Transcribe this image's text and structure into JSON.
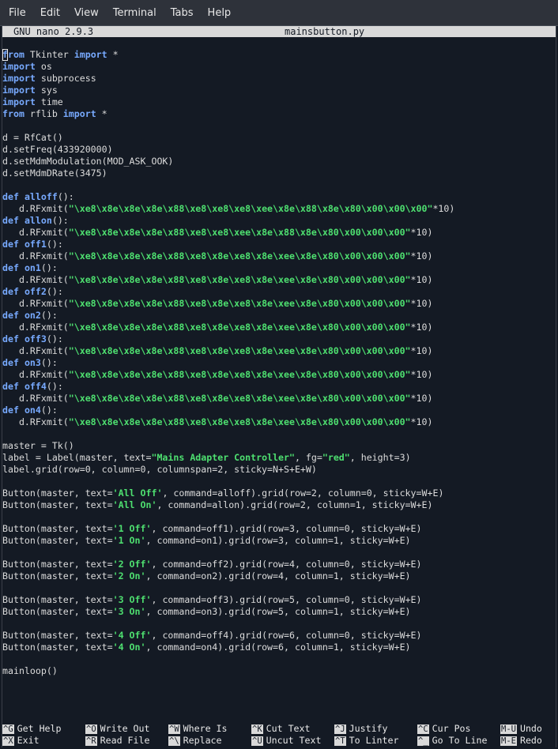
{
  "menubar": {
    "items": [
      "File",
      "Edit",
      "View",
      "Terminal",
      "Tabs",
      "Help"
    ]
  },
  "nano": {
    "version": "GNU nano 2.9.3",
    "filename": "mainsbutton.py"
  },
  "code_lines": [
    [
      [
        "kw",
        "from"
      ],
      [
        "p",
        " Tkinter "
      ],
      [
        "kw",
        "import"
      ],
      [
        "p",
        " *"
      ]
    ],
    [
      [
        "kw",
        "import"
      ],
      [
        "p",
        " os"
      ]
    ],
    [
      [
        "kw",
        "import"
      ],
      [
        "p",
        " subprocess"
      ]
    ],
    [
      [
        "kw",
        "import"
      ],
      [
        "p",
        " sys"
      ]
    ],
    [
      [
        "kw",
        "import"
      ],
      [
        "p",
        " time"
      ]
    ],
    [
      [
        "kw",
        "from"
      ],
      [
        "p",
        " rflib "
      ],
      [
        "kw",
        "import"
      ],
      [
        "p",
        " *"
      ]
    ],
    [],
    [
      [
        "p",
        "d = RfCat()"
      ]
    ],
    [
      [
        "p",
        "d.setFreq(433920000)"
      ]
    ],
    [
      [
        "p",
        "d.setMdmModulation(MOD_ASK_OOK)"
      ]
    ],
    [
      [
        "p",
        "d.setMdmDRate(3475)"
      ]
    ],
    [],
    [
      [
        "kw",
        "def"
      ],
      [
        "p",
        " "
      ],
      [
        "fn",
        "alloff"
      ],
      [
        "p",
        "():"
      ]
    ],
    [
      [
        "p",
        "   d.RFxmit("
      ],
      [
        "str",
        "\"\\xe8\\x8e\\x8e\\x8e\\x88\\xe8\\xe8\\xe8\\xee\\x8e\\x88\\x8e\\x80\\x00\\x00\\x00\""
      ],
      [
        "p",
        "*10)"
      ]
    ],
    [
      [
        "kw",
        "def"
      ],
      [
        "p",
        " "
      ],
      [
        "fn",
        "allon"
      ],
      [
        "p",
        "():"
      ]
    ],
    [
      [
        "p",
        "   d.RFxmit("
      ],
      [
        "str",
        "\"\\xe8\\x8e\\x8e\\x8e\\x88\\xe8\\xe8\\xee\\x8e\\x88\\x8e\\x80\\x00\\x00\\x00\""
      ],
      [
        "p",
        "*10)"
      ]
    ],
    [
      [
        "kw",
        "def"
      ],
      [
        "p",
        " "
      ],
      [
        "fn",
        "off1"
      ],
      [
        "p",
        "():"
      ]
    ],
    [
      [
        "p",
        "   d.RFxmit("
      ],
      [
        "str",
        "\"\\xe8\\x8e\\x8e\\x8e\\x88\\xe8\\x8e\\xe8\\x8e\\xee\\x8e\\x80\\x00\\x00\\x00\""
      ],
      [
        "p",
        "*10)"
      ]
    ],
    [
      [
        "kw",
        "def"
      ],
      [
        "p",
        " "
      ],
      [
        "fn",
        "on1"
      ],
      [
        "p",
        "():"
      ]
    ],
    [
      [
        "p",
        "   d.RFxmit("
      ],
      [
        "str",
        "\"\\xe8\\x8e\\x8e\\x8e\\x88\\xe8\\x8e\\xe8\\x8e\\xee\\x8e\\x80\\x00\\x00\\x00\""
      ],
      [
        "p",
        "*10)"
      ]
    ],
    [
      [
        "kw",
        "def"
      ],
      [
        "p",
        " "
      ],
      [
        "fn",
        "off2"
      ],
      [
        "p",
        "():"
      ]
    ],
    [
      [
        "p",
        "   d.RFxmit("
      ],
      [
        "str",
        "\"\\xe8\\x8e\\x8e\\x8e\\x88\\xe8\\x8e\\xe8\\x8e\\xee\\x8e\\x80\\x00\\x00\\x00\""
      ],
      [
        "p",
        "*10)"
      ]
    ],
    [
      [
        "kw",
        "def"
      ],
      [
        "p",
        " "
      ],
      [
        "fn",
        "on2"
      ],
      [
        "p",
        "():"
      ]
    ],
    [
      [
        "p",
        "   d.RFxmit("
      ],
      [
        "str",
        "\"\\xe8\\x8e\\x8e\\x8e\\x88\\xe8\\x8e\\xe8\\x8e\\xee\\x8e\\x80\\x00\\x00\\x00\""
      ],
      [
        "p",
        "*10)"
      ]
    ],
    [
      [
        "kw",
        "def"
      ],
      [
        "p",
        " "
      ],
      [
        "fn",
        "off3"
      ],
      [
        "p",
        "():"
      ]
    ],
    [
      [
        "p",
        "   d.RFxmit("
      ],
      [
        "str",
        "\"\\xe8\\x8e\\x8e\\x8e\\x88\\xe8\\x8e\\xe8\\x8e\\xee\\x8e\\x80\\x00\\x00\\x00\""
      ],
      [
        "p",
        "*10)"
      ]
    ],
    [
      [
        "kw",
        "def"
      ],
      [
        "p",
        " "
      ],
      [
        "fn",
        "on3"
      ],
      [
        "p",
        "():"
      ]
    ],
    [
      [
        "p",
        "   d.RFxmit("
      ],
      [
        "str",
        "\"\\xe8\\x8e\\x8e\\x8e\\x88\\xe8\\x8e\\xe8\\x8e\\xee\\x8e\\x80\\x00\\x00\\x00\""
      ],
      [
        "p",
        "*10)"
      ]
    ],
    [
      [
        "kw",
        "def"
      ],
      [
        "p",
        " "
      ],
      [
        "fn",
        "off4"
      ],
      [
        "p",
        "():"
      ]
    ],
    [
      [
        "p",
        "   d.RFxmit("
      ],
      [
        "str",
        "\"\\xe8\\x8e\\x8e\\x8e\\x88\\xe8\\x8e\\xe8\\x8e\\xee\\x8e\\x80\\x00\\x00\\x00\""
      ],
      [
        "p",
        "*10)"
      ]
    ],
    [
      [
        "kw",
        "def"
      ],
      [
        "p",
        " "
      ],
      [
        "fn",
        "on4"
      ],
      [
        "p",
        "():"
      ]
    ],
    [
      [
        "p",
        "   d.RFxmit("
      ],
      [
        "str",
        "\"\\xe8\\x8e\\x8e\\x8e\\x88\\xe8\\x8e\\xe8\\x8e\\xee\\x8e\\x80\\x00\\x00\\x00\""
      ],
      [
        "p",
        "*10)"
      ]
    ],
    [],
    [
      [
        "p",
        "master = Tk()"
      ]
    ],
    [
      [
        "p",
        "label = Label(master, text="
      ],
      [
        "str",
        "\"Mains Adapter Controller\""
      ],
      [
        "p",
        ", fg="
      ],
      [
        "str",
        "\"red\""
      ],
      [
        "p",
        ", height=3)"
      ]
    ],
    [
      [
        "p",
        "label.grid(row=0, column=0, columnspan=2, sticky=N+S+E+W)"
      ]
    ],
    [],
    [
      [
        "p",
        "Button(master, text="
      ],
      [
        "str",
        "'All Off'"
      ],
      [
        "p",
        ", command=alloff).grid(row=2, column=0, sticky=W+E)"
      ]
    ],
    [
      [
        "p",
        "Button(master, text="
      ],
      [
        "str",
        "'All On'"
      ],
      [
        "p",
        ", command=allon).grid(row=2, column=1, sticky=W+E)"
      ]
    ],
    [],
    [
      [
        "p",
        "Button(master, text="
      ],
      [
        "str",
        "'1 Off'"
      ],
      [
        "p",
        ", command=off1).grid(row=3, column=0, sticky=W+E)"
      ]
    ],
    [
      [
        "p",
        "Button(master, text="
      ],
      [
        "str",
        "'1 On'"
      ],
      [
        "p",
        ", command=on1).grid(row=3, column=1, sticky=W+E)"
      ]
    ],
    [],
    [
      [
        "p",
        "Button(master, text="
      ],
      [
        "str",
        "'2 Off'"
      ],
      [
        "p",
        ", command=off2).grid(row=4, column=0, sticky=W+E)"
      ]
    ],
    [
      [
        "p",
        "Button(master, text="
      ],
      [
        "str",
        "'2 On'"
      ],
      [
        "p",
        ", command=on2).grid(row=4, column=1, sticky=W+E)"
      ]
    ],
    [],
    [
      [
        "p",
        "Button(master, text="
      ],
      [
        "str",
        "'3 Off'"
      ],
      [
        "p",
        ", command=off3).grid(row=5, column=0, sticky=W+E)"
      ]
    ],
    [
      [
        "p",
        "Button(master, text="
      ],
      [
        "str",
        "'3 On'"
      ],
      [
        "p",
        ", command=on3).grid(row=5, column=1, sticky=W+E)"
      ]
    ],
    [],
    [
      [
        "p",
        "Button(master, text="
      ],
      [
        "str",
        "'4 Off'"
      ],
      [
        "p",
        ", command=off4).grid(row=6, column=0, sticky=W+E)"
      ]
    ],
    [
      [
        "p",
        "Button(master, text="
      ],
      [
        "str",
        "'4 On'"
      ],
      [
        "p",
        ", command=on4).grid(row=6, column=1, sticky=W+E)"
      ]
    ],
    [],
    [
      [
        "p",
        "mainloop()"
      ]
    ]
  ],
  "shortcuts": {
    "row1": [
      {
        "key": "^G",
        "label": "Get Help"
      },
      {
        "key": "^O",
        "label": "Write Out"
      },
      {
        "key": "^W",
        "label": "Where Is"
      },
      {
        "key": "^K",
        "label": "Cut Text"
      },
      {
        "key": "^J",
        "label": "Justify"
      },
      {
        "key": "^C",
        "label": "Cur Pos"
      },
      {
        "key": "M-U",
        "label": "Undo"
      }
    ],
    "row2": [
      {
        "key": "^X",
        "label": "Exit"
      },
      {
        "key": "^R",
        "label": "Read File"
      },
      {
        "key": "^\\",
        "label": "Replace"
      },
      {
        "key": "^U",
        "label": "Uncut Text"
      },
      {
        "key": "^T",
        "label": "To Linter"
      },
      {
        "key": "^_",
        "label": "Go To Line"
      },
      {
        "key": "M-E",
        "label": "Redo"
      }
    ]
  }
}
